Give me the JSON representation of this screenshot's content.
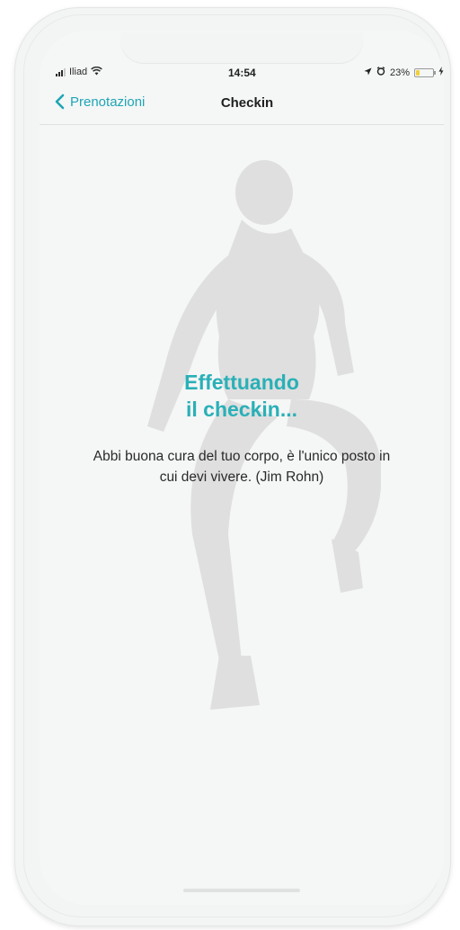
{
  "status_bar": {
    "carrier": "Iliad",
    "time": "14:54",
    "battery_percent": "23%",
    "battery_level": 0.23,
    "icons": [
      "signal-icon",
      "wifi-icon",
      "location-icon",
      "alarm-icon",
      "battery-icon",
      "charge-icon"
    ]
  },
  "nav": {
    "back_label": "Prenotazioni",
    "title": "Checkin"
  },
  "main": {
    "loading_title_line1": "Effettuando",
    "loading_title_line2": "il checkin...",
    "quote": "Abbi buona cura del tuo corpo, è l'unico posto in cui devi vivere. (Jim Rohn)"
  },
  "colors": {
    "accent": "#1fa5b5",
    "title": "#2ab0b7",
    "background": "#f5f6f6"
  }
}
